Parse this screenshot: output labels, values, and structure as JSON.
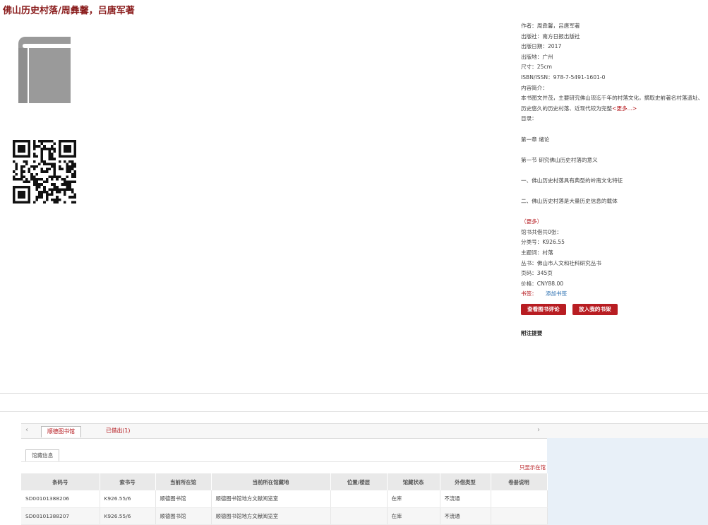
{
  "title": "佛山历史村落/周彝馨，吕唐军著",
  "meta": {
    "author": "作者：周彝馨，吕唐军著",
    "publisher": "出版社：南方日报出版社",
    "pub_date": "出版日期：2017",
    "pub_place": "出版地：广州",
    "size": "尺寸：25cm",
    "isbn": "ISBN/ISSN：978-7-5491-1601-0",
    "intro_label": "内容简介：",
    "intro_text": "本书图文并茂，主要研究佛山现迄千年的村落文化，摘取史前著名村落遗址、历史悠久的历史村落、近现代较为完整",
    "intro_more": "<更多...>",
    "toc_label": "目录：",
    "toc": [
      "第一章 绪论",
      "第一节 研究佛山历史村落的意义",
      "一、佛山历史村落具有典型的岭南文化特征",
      "二、佛山历史村落是大量历史信息的载体"
    ],
    "toc_more": "（更多）",
    "collection_count": "馆书共借共0张：",
    "classification": "分类号：K926.55",
    "subject": "主题词：村落",
    "series": "丛书：佛山市人文和社科研究丛书",
    "pages": "页码：345页",
    "price": "价格：CNY88.00",
    "tags_label": "书签：",
    "add_tag": "添加书签"
  },
  "buttons": {
    "review": "查看图书评论",
    "add_shelf": "放入我的书架"
  },
  "annotation_label": "附注提要",
  "tabs": {
    "left_arrow": "‹",
    "right_arrow": "›",
    "tab1": "顺德图书馆",
    "tab2": "已借出(1)"
  },
  "subtab": "馆藏信息",
  "lib_only": "只显示在馆",
  "table": {
    "headers": [
      "条码号",
      "索书号",
      "当前所在馆",
      "当前所在馆藏地",
      "位置/楼层",
      "馆藏状态",
      "外借类型",
      "卷册说明"
    ],
    "rows": [
      [
        "SD00101388206",
        "K926.55/6",
        "顺德图书馆",
        "顺德图书馆地方文献阅览室",
        "",
        "在库",
        "不流通",
        ""
      ],
      [
        "SD00101388207",
        "K926.55/6",
        "顺德图书馆",
        "顺德图书馆地方文献阅览室",
        "",
        "在库",
        "不流通",
        ""
      ]
    ]
  },
  "colors": {
    "accent": "#b81d22",
    "title": "#8a1c1c"
  }
}
